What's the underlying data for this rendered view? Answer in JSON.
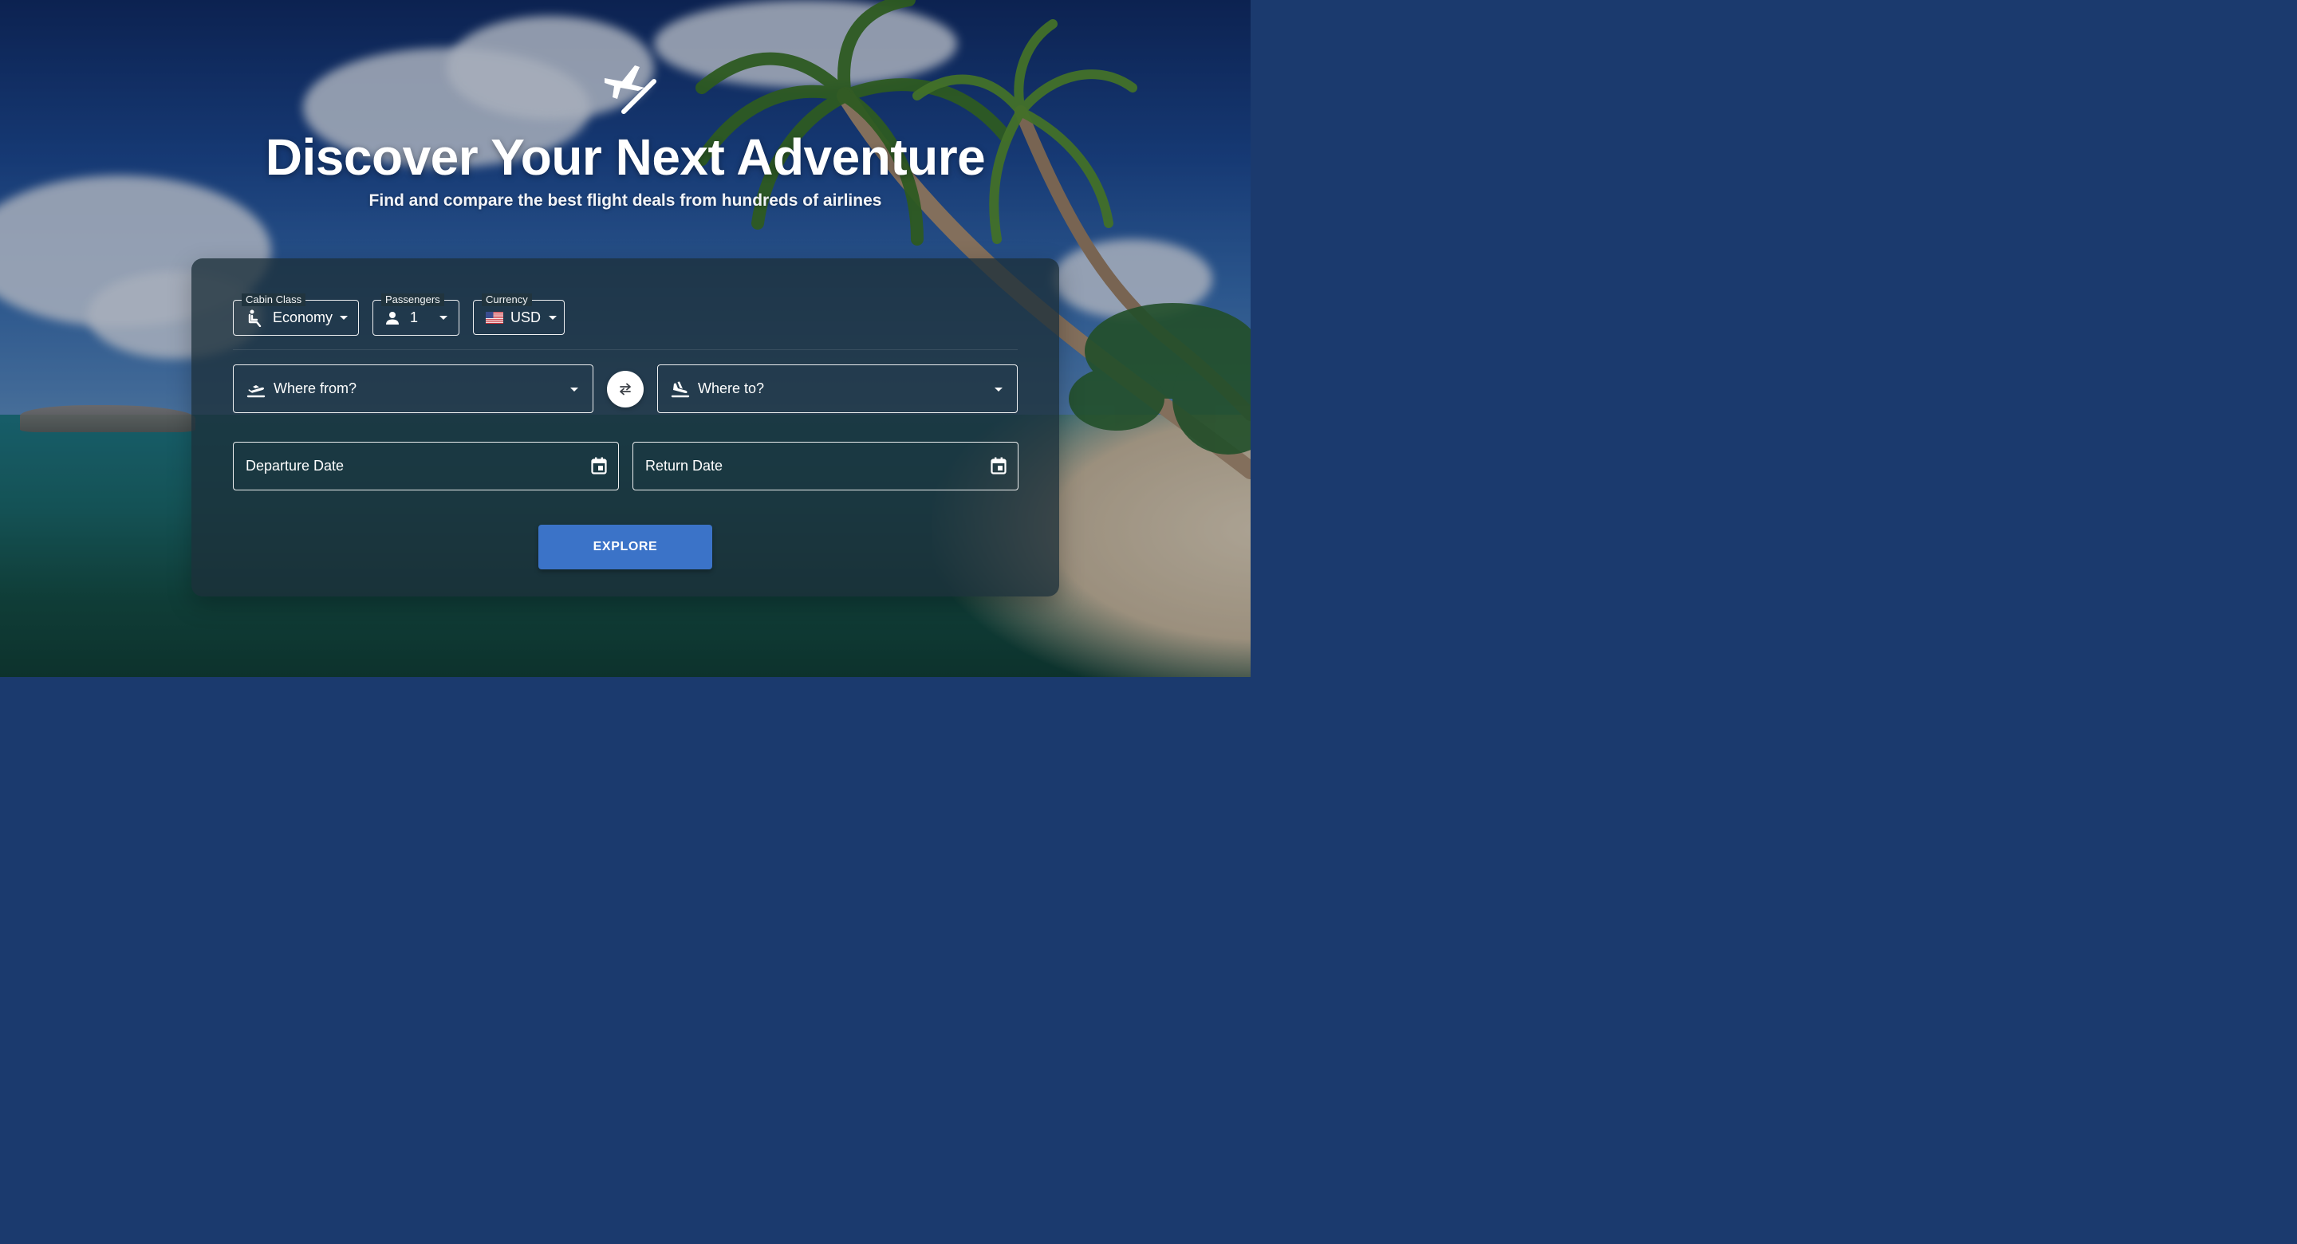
{
  "hero": {
    "icon": "flight-takeoff-icon",
    "title": "Discover Your Next Adventure",
    "subtitle": "Find and compare the best flight deals from hundreds of airlines"
  },
  "filters": {
    "cabin_class": {
      "label": "Cabin Class",
      "value": "Economy",
      "icon": "seat-icon"
    },
    "passengers": {
      "label": "Passengers",
      "value": "1",
      "icon": "person-icon"
    },
    "currency": {
      "label": "Currency",
      "value": "USD",
      "icon": "us-flag-icon"
    }
  },
  "route": {
    "origin_placeholder": "Where from?",
    "origin_icon": "flight-takeoff-icon",
    "destination_placeholder": "Where to?",
    "destination_icon": "flight-land-icon",
    "swap_icon": "swap-icon"
  },
  "dates": {
    "departure_label": "Departure Date",
    "return_label": "Return Date",
    "calendar_icon": "calendar-icon"
  },
  "actions": {
    "explore_label": "EXPLORE"
  },
  "colors": {
    "accent": "#3b73c8",
    "card": "#1c303a",
    "text": "#ffffff"
  }
}
